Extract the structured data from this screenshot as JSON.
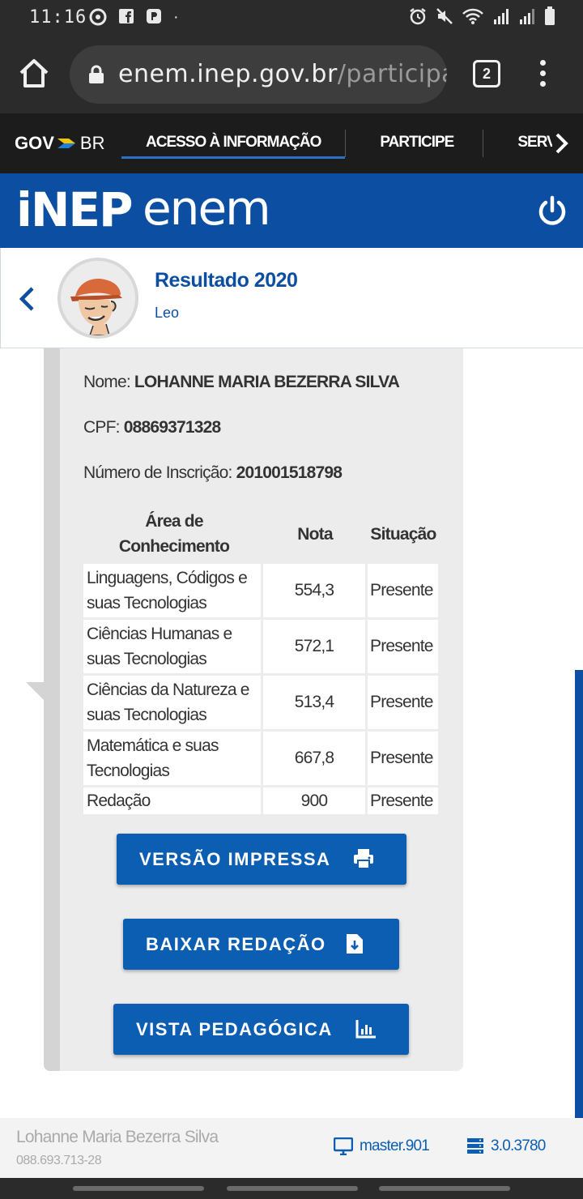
{
  "status": {
    "time": "11:16"
  },
  "browser": {
    "url_host": "enem.inep.gov.br",
    "url_path": "/participante",
    "tab_count": "2"
  },
  "govbar": {
    "logo_gov": "GOV",
    "logo_br": "BR",
    "items": [
      "ACESSO À INFORMAÇÃO",
      "PARTICIPE",
      "SERVIÇ"
    ]
  },
  "brand": {
    "inep": "iNEP",
    "enem": "enem"
  },
  "header": {
    "title": "Resultado 2020",
    "subtitle": "Leo"
  },
  "participant": {
    "name_label": "Nome:",
    "name_value": "LOHANNE MARIA BEZERRA SILVA",
    "cpf_label": "CPF:",
    "cpf_value": "08869371328",
    "inscricao_label": "Número de Inscrição:",
    "inscricao_value": "201001518798"
  },
  "table": {
    "headers": [
      "Área de Conhecimento",
      "Nota",
      "Situação"
    ],
    "rows": [
      {
        "area": "Linguagens, Códigos e suas Tecnologias",
        "nota": "554,3",
        "situacao": "Presente"
      },
      {
        "area": "Ciências Humanas e suas Tecnologias",
        "nota": "572,1",
        "situacao": "Presente"
      },
      {
        "area": "Ciências da Natureza e suas Tecnologias",
        "nota": "513,4",
        "situacao": "Presente"
      },
      {
        "area": "Matemática e suas Tecnologias",
        "nota": "667,8",
        "situacao": "Presente"
      },
      {
        "area": "Redação",
        "nota": "900",
        "situacao": "Presente"
      }
    ]
  },
  "buttons": {
    "print": "VERSÃO IMPRESSA",
    "download": "BAIXAR REDAÇÃO",
    "pedagogic": "VISTA PEDAGÓGICA"
  },
  "footer": {
    "name": "Lohanne Maria Bezerra Silva",
    "cpf": "088.693.713-28",
    "version": "master.901",
    "build": "3.0.3780"
  },
  "colors": {
    "primary": "#0c4ea2",
    "button": "#0c5eb3",
    "govbar": "#1c1c1c"
  }
}
